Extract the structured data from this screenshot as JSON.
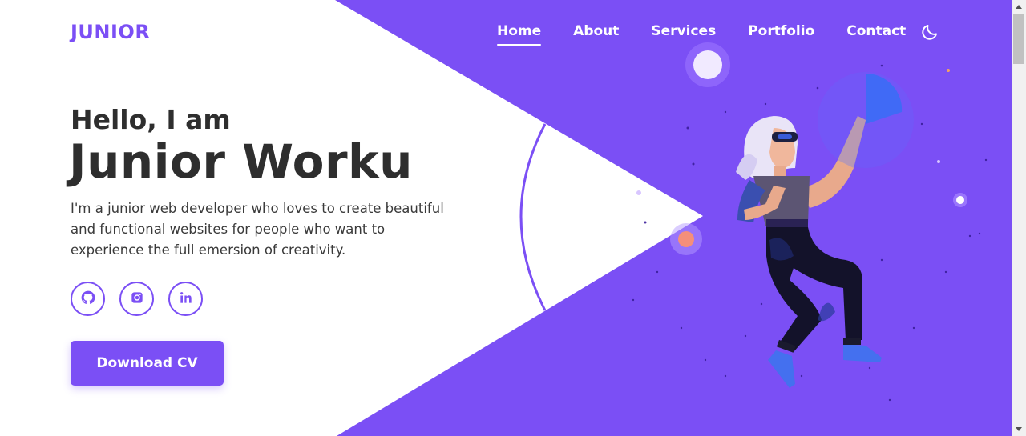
{
  "header": {
    "logo": "JUNIOR",
    "nav": [
      {
        "label": "Home",
        "active": true
      },
      {
        "label": "About",
        "active": false
      },
      {
        "label": "Services",
        "active": false
      },
      {
        "label": "Portfolio",
        "active": false
      },
      {
        "label": "Contact",
        "active": false
      }
    ],
    "theme_toggle_icon": "moon-icon"
  },
  "hero": {
    "greeting": "Hello, I am",
    "name": "Junior Worku",
    "bio": "I'm a junior web developer who loves to create beautiful and functional websites for people who want to experience the full emersion of creativity.",
    "socials": [
      {
        "name": "github",
        "icon": "github-icon"
      },
      {
        "name": "instagram",
        "icon": "instagram-icon"
      },
      {
        "name": "linkedin",
        "icon": "linkedin-icon"
      }
    ],
    "download_label": "Download CV"
  },
  "colors": {
    "accent": "#7b4ff5",
    "text_dark": "#2e2e2e",
    "background": "#ffffff"
  }
}
